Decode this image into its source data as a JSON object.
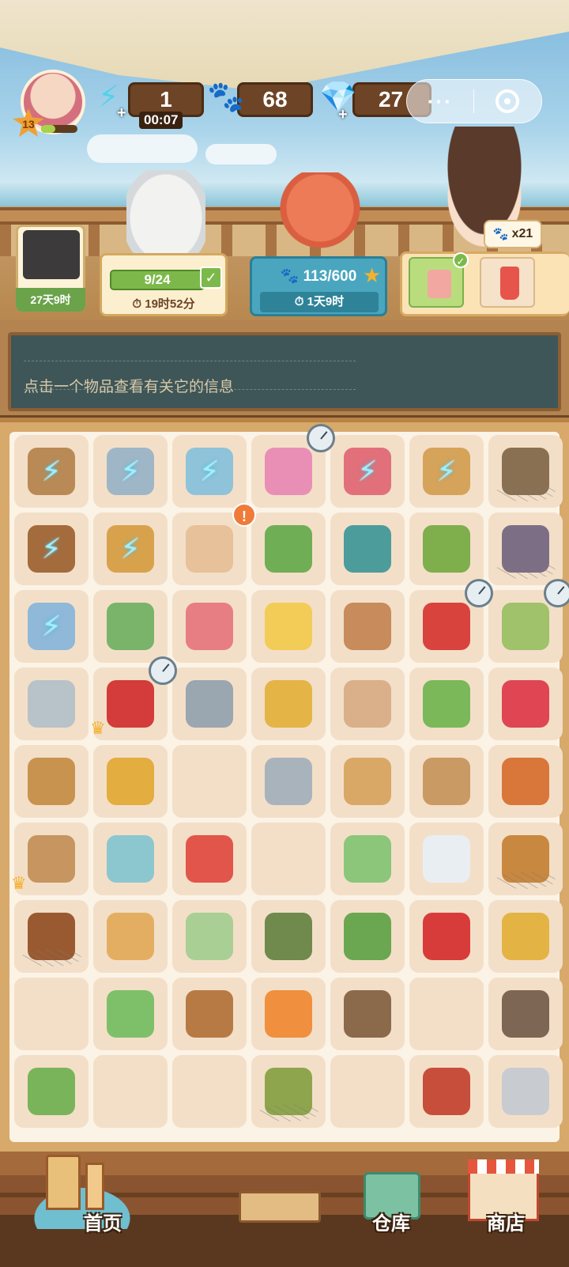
{
  "hud": {
    "player_level": "13",
    "xp_fraction": 0.4,
    "energy": {
      "value": "1",
      "timer": "00:07",
      "icon": "lightning-icon"
    },
    "paws": {
      "value": "68",
      "icon": "paw-coin-icon"
    },
    "gems": {
      "value": "27",
      "icon": "diamond-icon"
    },
    "capsule": {
      "more": "···",
      "target": "target-icon"
    }
  },
  "orders": {
    "left_card_time": "27天9时",
    "middle": {
      "progress": "9/24",
      "time": "19时52分"
    },
    "event": {
      "progress": "113/600",
      "time": "1天9时"
    },
    "reward_badge": "x21"
  },
  "info": {
    "hint": "点击一个物品查看有关它的信息"
  },
  "grid": {
    "rows": [
      [
        {
          "name": "wooden-bucket",
          "color": "#b98a55",
          "locked": true
        },
        {
          "name": "bbq-grill",
          "color": "#9fb6c7",
          "locked": true
        },
        {
          "name": "ice-shaver",
          "color": "#8fc3d9",
          "locked": true
        },
        {
          "name": "claw-machine-pink",
          "color": "#e98fb6",
          "locked": false,
          "timer": true
        },
        {
          "name": "vending-machine-red",
          "color": "#e1707a",
          "locked": true
        },
        {
          "name": "straw-hut",
          "color": "#d6a35a",
          "locked": true
        },
        {
          "name": "clay-pot",
          "color": "#8a7052",
          "locked": false,
          "web": true
        }
      ],
      [
        {
          "name": "fishing-bow",
          "color": "#a46b3c",
          "locked": true
        },
        {
          "name": "heart-frame",
          "color": "#d8a24d",
          "locked": true
        },
        {
          "name": "sprout-pot",
          "color": "#e6c19a",
          "locked": false
        },
        {
          "name": "berry-bush-pot",
          "color": "#6fae55",
          "locked": false,
          "alert": true
        },
        {
          "name": "hose-ring",
          "color": "#4d9c9c",
          "locked": false
        },
        {
          "name": "garden-fork",
          "color": "#7fae4d",
          "locked": false
        },
        {
          "name": "gardening-glove",
          "color": "#7c6f85",
          "locked": false,
          "web": true
        }
      ],
      [
        {
          "name": "glass-cabinet",
          "color": "#8fb8d9",
          "locked": true
        },
        {
          "name": "paint-can",
          "color": "#7ab36a",
          "locked": false
        },
        {
          "name": "pink-soap-piece",
          "color": "#e77e83",
          "locked": false
        },
        {
          "name": "sponge-cake",
          "color": "#f2cc57",
          "locked": false
        },
        {
          "name": "seed-sprout",
          "color": "#c78b5c",
          "locked": false
        },
        {
          "name": "rose-flower-pot",
          "color": "#d9433e",
          "locked": false,
          "timer": true
        },
        {
          "name": "green-vase",
          "color": "#9fc26a",
          "locked": false,
          "timer": true
        }
      ],
      [
        {
          "name": "cat-keychain",
          "color": "#b8c2c9",
          "locked": false
        },
        {
          "name": "rose-bouquet",
          "color": "#d43b3b",
          "locked": false,
          "timer": true,
          "crown": true
        },
        {
          "name": "metal-screw",
          "color": "#9aa6b0",
          "locked": false
        },
        {
          "name": "cleaning-cloth",
          "color": "#e4b446",
          "locked": false
        },
        {
          "name": "bean-seed",
          "color": "#d9b08a",
          "locked": false
        },
        {
          "name": "seedling-pot",
          "color": "#7ab85a",
          "locked": false
        },
        {
          "name": "rose-petals",
          "color": "#df4553",
          "locked": false
        }
      ],
      [
        {
          "name": "wood-planks",
          "color": "#c8934f",
          "locked": false
        },
        {
          "name": "gold-coin-pouch",
          "color": "#e3ad3f",
          "locked": false
        },
        {
          "name": "",
          "color": "",
          "locked": false
        },
        {
          "name": "wire-hanger",
          "color": "#a9b3bb",
          "locked": false
        },
        {
          "name": "wooden-disk",
          "color": "#d9a867",
          "locked": false
        },
        {
          "name": "go-board",
          "color": "#c99a63",
          "locked": false
        },
        {
          "name": "chocolate-bar",
          "color": "#d9763a",
          "locked": false
        }
      ],
      [
        {
          "name": "calendar-notebook",
          "color": "#c69560",
          "locked": false,
          "crown": true
        },
        {
          "name": "cat-apron",
          "color": "#8cc7cf",
          "locked": false
        },
        {
          "name": "juice-glass",
          "color": "#e2554b",
          "locked": false
        },
        {
          "name": "",
          "color": "",
          "locked": false
        },
        {
          "name": "soap-bar",
          "color": "#8bc67a",
          "locked": false
        },
        {
          "name": "milk-bottle",
          "color": "#e9eef2",
          "locked": false
        },
        {
          "name": "rope-coil",
          "color": "#c9883f",
          "locked": false,
          "web": true
        }
      ],
      [
        {
          "name": "meatball-plate",
          "color": "#9a5a31",
          "locked": false,
          "web": true
        },
        {
          "name": "seashell",
          "color": "#e4ae62",
          "locked": false
        },
        {
          "name": "ceramic-vase",
          "color": "#a9cf94",
          "locked": false
        },
        {
          "name": "garden-trowel",
          "color": "#6f8a4c",
          "locked": false
        },
        {
          "name": "lotus-leaf",
          "color": "#6aa750",
          "locked": false
        },
        {
          "name": "cola-can",
          "color": "#d83c3a",
          "locked": false
        },
        {
          "name": "corn-stick",
          "color": "#e3b344",
          "locked": false
        }
      ],
      [
        {
          "name": "",
          "color": "",
          "locked": false
        },
        {
          "name": "spray-bottle",
          "color": "#7ec06a",
          "locked": false
        },
        {
          "name": "slingshot-rope",
          "color": "#b87a45",
          "locked": false
        },
        {
          "name": "candy",
          "color": "#f08f3e",
          "locked": false
        },
        {
          "name": "hand-axe",
          "color": "#8b6a4c",
          "locked": false
        },
        {
          "name": "",
          "color": "",
          "locked": false
        },
        {
          "name": "hatchet",
          "color": "#7d6654",
          "locked": false
        }
      ],
      [
        {
          "name": "grass-tuft",
          "color": "#79b45a",
          "locked": false
        },
        {
          "name": "",
          "color": "",
          "locked": false
        },
        {
          "name": "",
          "color": "",
          "locked": false
        },
        {
          "name": "kiwi-basket",
          "color": "#8ea54d",
          "locked": false,
          "web": true
        },
        {
          "name": "",
          "color": "",
          "locked": false
        },
        {
          "name": "raccoon-snack-bag",
          "color": "#c84e3c",
          "locked": false
        },
        {
          "name": "tin-can",
          "color": "#c8ccd1",
          "locked": false
        }
      ]
    ]
  },
  "nav": {
    "home": "首页",
    "warehouse": "仓库",
    "shop": "商店"
  }
}
